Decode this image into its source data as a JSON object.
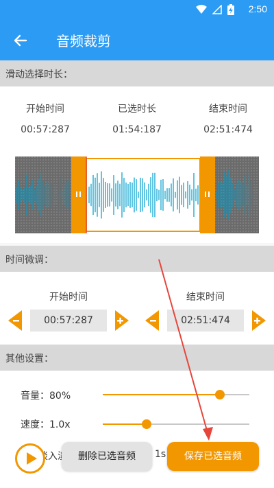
{
  "status_bar": {
    "time": "2:50",
    "icons": [
      "wifi-icon",
      "signal-icon",
      "battery-charging-icon"
    ]
  },
  "app_bar": {
    "title": "音频裁剪",
    "back_icon": "arrow-left-icon"
  },
  "colors": {
    "primary": "#2b9bf4",
    "accent": "#f29700",
    "waveform": "#3bb6d8"
  },
  "selection_section": {
    "header": "滑动选择时长：",
    "start_label": "开始时间",
    "duration_label": "已选时长",
    "end_label": "结束时间",
    "start_value": "00:57:287",
    "duration_value": "01:54:187",
    "end_value": "02:51:474"
  },
  "fine_tune_section": {
    "header": "时间微调：",
    "start_label": "开始时间",
    "end_label": "结束时间",
    "start_value": "00:57:287",
    "end_value": "02:51:474",
    "minus_icon": "minus-icon",
    "plus_icon": "plus-icon"
  },
  "other_settings": {
    "header": "其他设置：",
    "volume_label": "音量：80%",
    "volume_level": 0.8,
    "speed_label": "速度：1.0x",
    "speed_level": 0.3,
    "fade_label": "淡入淡出",
    "fade_value": "1s"
  },
  "actions": {
    "play_icon": "play-icon",
    "delete_label": "删除已选音频",
    "save_label": "保存已选音频"
  }
}
